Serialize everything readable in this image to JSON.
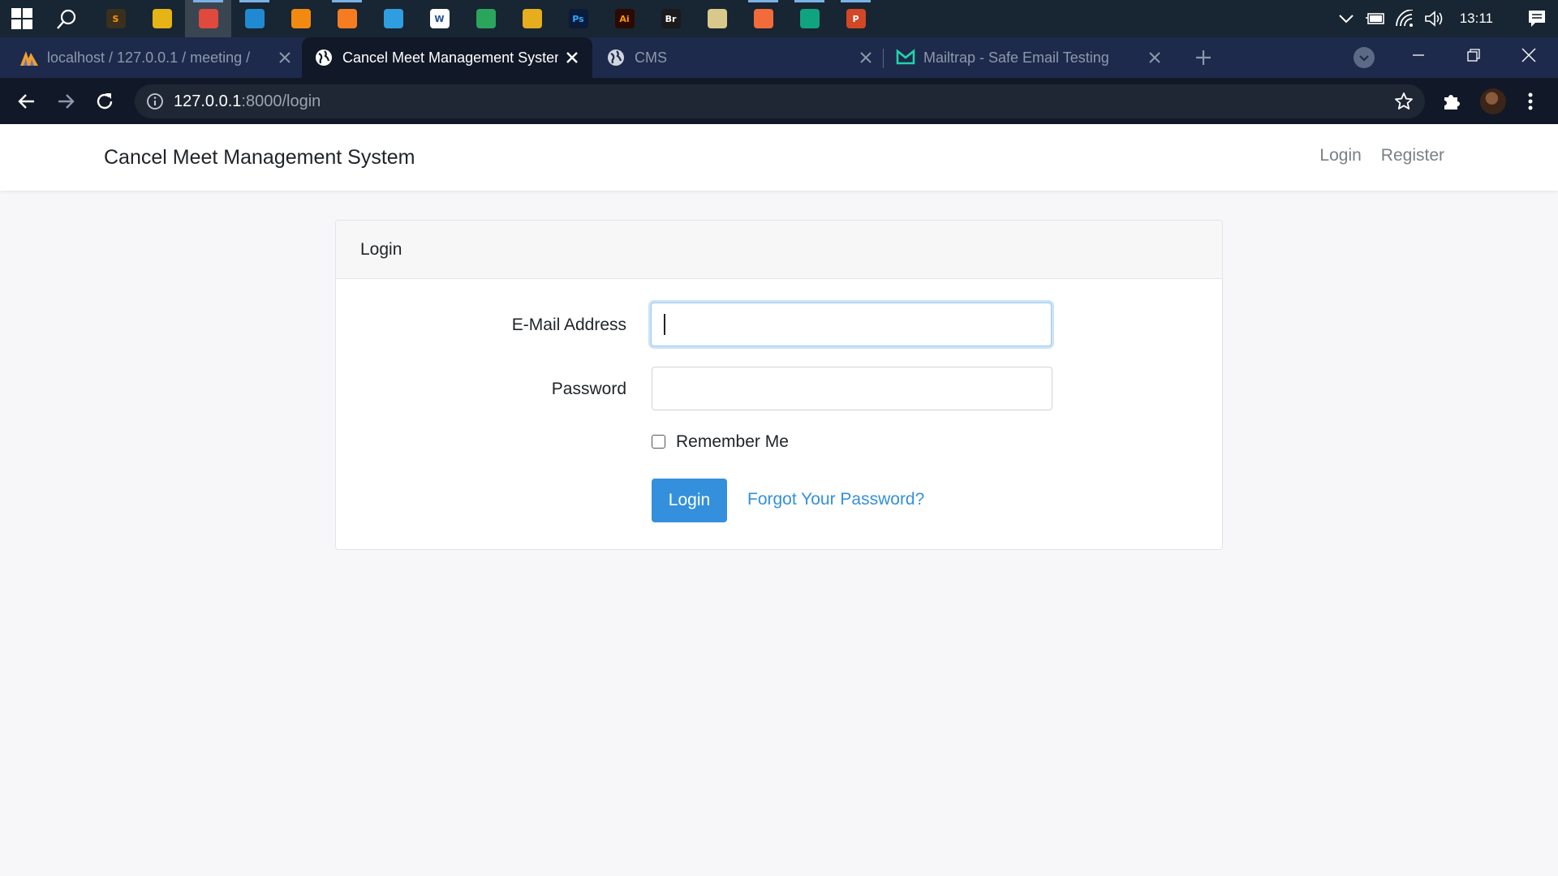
{
  "taskbar": {
    "apps": [
      {
        "icon": "sublime-text-icon",
        "color": "#3b2f1e",
        "glyph": "S",
        "fg": "#ff9800",
        "active": false,
        "running": false
      },
      {
        "icon": "file-explorer-icon",
        "color": "#e7b416",
        "glyph": "",
        "fg": "#fff",
        "active": false,
        "running": false
      },
      {
        "icon": "chrome-icon",
        "color": "#e04a3c",
        "glyph": "",
        "fg": "#fff",
        "active": true,
        "running": true
      },
      {
        "icon": "vscode-icon",
        "color": "#1f8ad2",
        "glyph": "",
        "fg": "#fff",
        "active": false,
        "running": true
      },
      {
        "icon": "vlc-icon",
        "color": "#f28a12",
        "glyph": "",
        "fg": "#fff",
        "active": false,
        "running": false
      },
      {
        "icon": "xampp-icon",
        "color": "#f57c20",
        "glyph": "",
        "fg": "#fff",
        "active": false,
        "running": true
      },
      {
        "icon": "figma-like-icon",
        "color": "#2f9ee0",
        "glyph": "",
        "fg": "#fff",
        "active": false,
        "running": false
      },
      {
        "icon": "wamp-icon",
        "color": "#ffffff",
        "glyph": "W",
        "fg": "#1f4e8c",
        "active": false,
        "running": false
      },
      {
        "icon": "edge-icon",
        "color": "#2aa55b",
        "glyph": "",
        "fg": "#fff",
        "active": false,
        "running": false
      },
      {
        "icon": "git-icon",
        "color": "#e6ad1e",
        "glyph": "",
        "fg": "#fff",
        "active": false,
        "running": false
      },
      {
        "icon": "photoshop-icon",
        "color": "#0b1b3a",
        "glyph": "Ps",
        "fg": "#31a8ff",
        "active": false,
        "running": false
      },
      {
        "icon": "illustrator-icon",
        "color": "#2b0a00",
        "glyph": "Ai",
        "fg": "#ff9a00",
        "active": false,
        "running": false
      },
      {
        "icon": "bridge-icon",
        "color": "#1b1b1b",
        "glyph": "Br",
        "fg": "#ffffff",
        "active": false,
        "running": false
      },
      {
        "icon": "disc-icon",
        "color": "#d8c98a",
        "glyph": "",
        "fg": "#fff",
        "active": false,
        "running": false
      },
      {
        "icon": "postman-icon",
        "color": "#f26b3a",
        "glyph": "",
        "fg": "#fff",
        "active": false,
        "running": true
      },
      {
        "icon": "chatgpt-icon",
        "color": "#10a37f",
        "glyph": "",
        "fg": "#fff",
        "active": false,
        "running": true
      },
      {
        "icon": "powerpoint-icon",
        "color": "#d24726",
        "glyph": "P",
        "fg": "#fff",
        "active": false,
        "running": true
      }
    ],
    "clock": "13:11"
  },
  "browser": {
    "tabs": [
      {
        "title": "localhost / 127.0.0.1 / meeting / ",
        "favicon": "phpmyadmin-icon",
        "active": false
      },
      {
        "title": "Cancel Meet Management System",
        "favicon": "globe-icon",
        "active": true
      },
      {
        "title": "CMS",
        "favicon": "globe-icon",
        "active": false
      },
      {
        "title": "Mailtrap - Safe Email Testing",
        "favicon": "mailtrap-icon",
        "active": false
      }
    ],
    "url_host": "127.0.0.1",
    "url_rest": ":8000/login"
  },
  "page": {
    "brand": "Cancel Meet Management System",
    "nav_login": "Login",
    "nav_register": "Register",
    "card_title": "Login",
    "email_label": "E-Mail Address",
    "email_value": "",
    "password_label": "Password",
    "password_value": "",
    "remember_label": "Remember Me",
    "remember_checked": false,
    "login_button": "Login",
    "forgot_link": "Forgot Your Password?"
  },
  "colors": {
    "primary": "#3490dc",
    "taskbar": "#182532",
    "browser_chrome": "#111827"
  }
}
